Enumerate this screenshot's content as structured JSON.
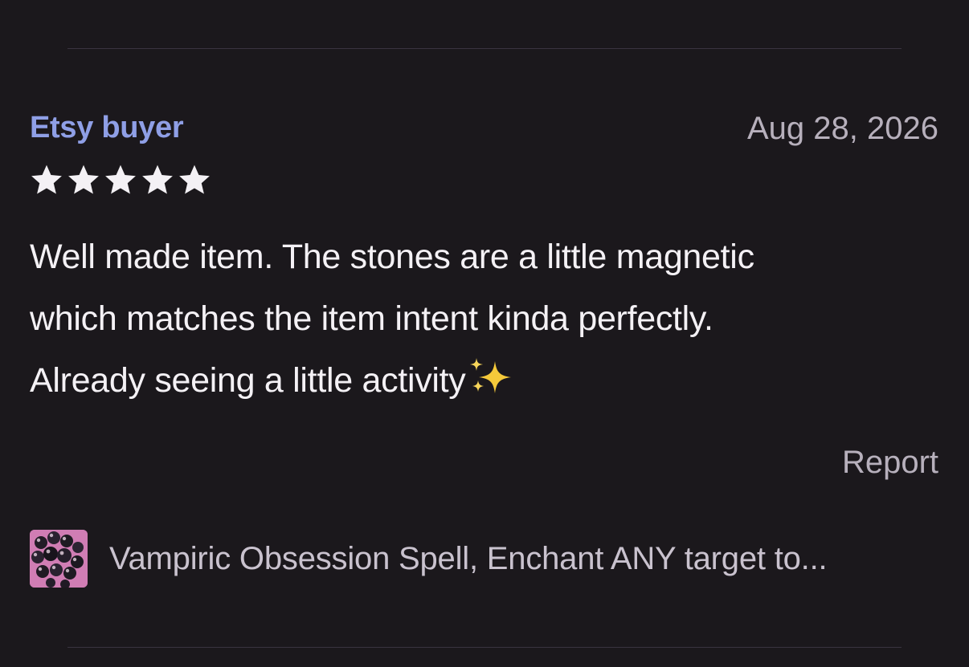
{
  "review": {
    "reviewer_name": "Etsy buyer",
    "date": "Aug 28, 2026",
    "rating": 5,
    "rating_max": 5,
    "text_line1": "Well made item. The stones are a little magnetic",
    "text_line2": "which matches the item intent kinda perfectly.",
    "text_line3": "Already seeing a little activity",
    "text_emoji": "sparkles-icon",
    "report_label": "Report"
  },
  "item": {
    "title": "Vampiric Obsession Spell, Enchant ANY target to...",
    "thumbnail_icon": "product-thumbnail"
  },
  "colors": {
    "background": "#1b181c",
    "reviewer_name": "#8f9fe6",
    "secondary_text": "#b7b0bc",
    "primary_text": "#f4f1f5",
    "star": "#f4f1f5",
    "sparkle": "#f5c93a"
  }
}
